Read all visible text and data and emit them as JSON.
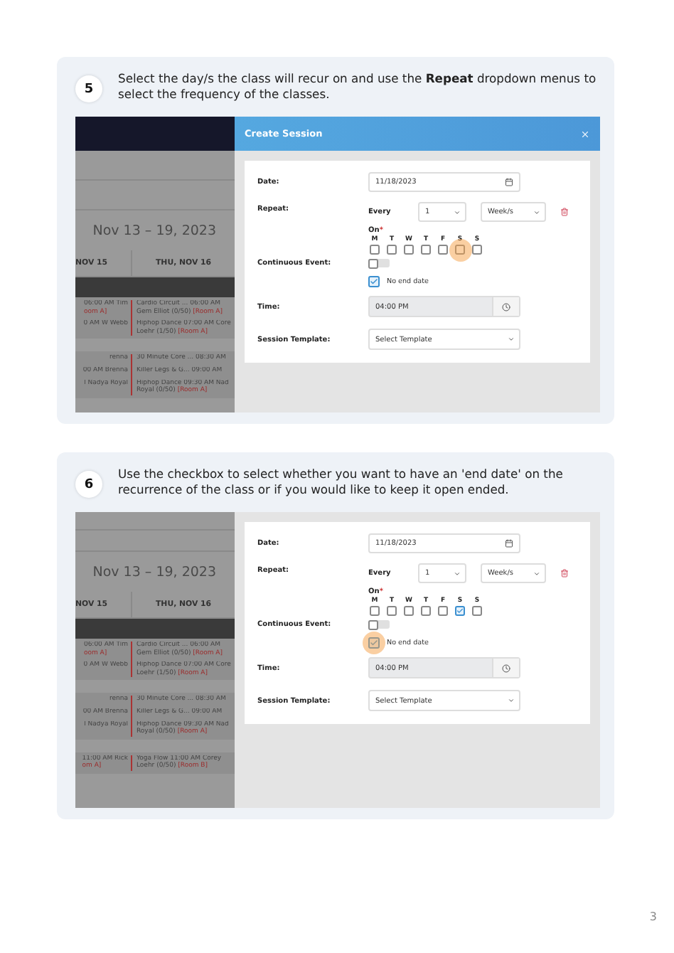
{
  "steps": [
    {
      "number": "5",
      "instruction": "Select the day/s the class will recur on and use the **Repeat** dropdown menus to select the frequency of the classes.",
      "screenshot": {
        "dialog_title": "Create Session",
        "calendar": {
          "top_bar": true,
          "week_title": "Nov 13 – 19, 2023",
          "columns": [
            "NOV 15",
            "THU, NOV 16"
          ],
          "groups": [
            {
              "events": [
                {
                  "left": {
                    "title": "06:00 AM Tim",
                    "room": "oom A]"
                  },
                  "right": {
                    "title": "Cardio Circuit ... 06:00 AM",
                    "detail": "Gem Elliot (0/50)",
                    "room": "[Room A]"
                  }
                },
                {
                  "left": {
                    "title": "0 AM W Webb"
                  },
                  "right": {
                    "title": "Hiphop Dance 07:00 AM Core",
                    "detail": "Loehr (1/50)",
                    "room": "[Room A]"
                  }
                }
              ]
            },
            {
              "events": [
                {
                  "left": {
                    "title": "renna"
                  },
                  "right": {
                    "title": "30 Minute Core ... 08:30 AM"
                  }
                },
                {
                  "left": {
                    "title": "00 AM Brenna"
                  },
                  "right": {
                    "title": "Killer Legs & G... 09:00 AM"
                  }
                },
                {
                  "left": {
                    "title": "l Nadya Royal"
                  },
                  "right": {
                    "title": "Hiphop Dance 09:30 AM Nad",
                    "detail": "Royal (0/50)",
                    "room": "[Room A]"
                  }
                }
              ]
            }
          ]
        },
        "form": {
          "date": {
            "label": "Date:",
            "value": "11/18/2023"
          },
          "repeat": {
            "label": "Repeat:",
            "every": "Every",
            "count": "1",
            "unit": "Week/s"
          },
          "on": {
            "label": "On",
            "required": "*"
          },
          "days": [
            {
              "label": "M",
              "checked": false,
              "highlighted": false
            },
            {
              "label": "T",
              "checked": false,
              "highlighted": false
            },
            {
              "label": "W",
              "checked": false,
              "highlighted": false
            },
            {
              "label": "T",
              "checked": false,
              "highlighted": false
            },
            {
              "label": "F",
              "checked": false,
              "highlighted": false
            },
            {
              "label": "S",
              "checked": false,
              "highlighted": true
            },
            {
              "label": "S",
              "checked": false,
              "highlighted": false
            }
          ],
          "continuous": {
            "label": "Continuous Event:",
            "on": false
          },
          "no_end_date": {
            "label": "No end date",
            "checked": true,
            "highlighted": false
          },
          "time": {
            "label": "Time:",
            "value": "04:00 PM"
          },
          "template": {
            "label": "Session Template:",
            "value": "Select Template"
          }
        }
      }
    },
    {
      "number": "6",
      "instruction": "Use the checkbox to select whether you want to have an 'end date' on the recurrence of the class or if you would like to keep it open ended.",
      "screenshot": {
        "calendar": {
          "top_bar": false,
          "week_title": "Nov 13 – 19, 2023",
          "columns": [
            "NOV 15",
            "THU, NOV 16"
          ],
          "groups": [
            {
              "events": [
                {
                  "left": {
                    "title": "06:00 AM Tim",
                    "room": "oom A]"
                  },
                  "right": {
                    "title": "Cardio Circuit ... 06:00 AM",
                    "detail": "Gem Elliot (0/50)",
                    "room": "[Room A]"
                  }
                },
                {
                  "left": {
                    "title": "0 AM W Webb"
                  },
                  "right": {
                    "title": "Hiphop Dance 07:00 AM Core",
                    "detail": "Loehr (1/50)",
                    "room": "[Room A]"
                  }
                }
              ]
            },
            {
              "events": [
                {
                  "left": {
                    "title": "renna"
                  },
                  "right": {
                    "title": "30 Minute Core ... 08:30 AM"
                  }
                },
                {
                  "left": {
                    "title": "00 AM Brenna"
                  },
                  "right": {
                    "title": "Killer Legs & G... 09:00 AM"
                  }
                },
                {
                  "left": {
                    "title": "l Nadya Royal"
                  },
                  "right": {
                    "title": "Hiphop Dance 09:30 AM Nad",
                    "detail": "Royal (0/50)",
                    "room": "[Room A]"
                  }
                }
              ]
            },
            {
              "events": [
                {
                  "left": {
                    "title": "11:00 AM Rick",
                    "room": "om A]"
                  },
                  "right": {
                    "title": "Yoga Flow 11:00 AM Corey",
                    "detail": "Loehr (0/50)",
                    "room": "[Room B]"
                  }
                }
              ]
            }
          ]
        },
        "form": {
          "date": {
            "label": "Date:",
            "value": "11/18/2023"
          },
          "repeat": {
            "label": "Repeat:",
            "every": "Every",
            "count": "1",
            "unit": "Week/s"
          },
          "on": {
            "label": "On",
            "required": "*"
          },
          "days": [
            {
              "label": "M",
              "checked": false,
              "highlighted": false
            },
            {
              "label": "T",
              "checked": false,
              "highlighted": false
            },
            {
              "label": "W",
              "checked": false,
              "highlighted": false
            },
            {
              "label": "T",
              "checked": false,
              "highlighted": false
            },
            {
              "label": "F",
              "checked": false,
              "highlighted": false
            },
            {
              "label": "S",
              "checked": true,
              "highlighted": false
            },
            {
              "label": "S",
              "checked": false,
              "highlighted": false
            }
          ],
          "continuous": {
            "label": "Continuous Event:",
            "on": false
          },
          "no_end_date": {
            "label": "No end date",
            "checked": true,
            "highlighted": true
          },
          "time": {
            "label": "Time:",
            "value": "04:00 PM"
          },
          "template": {
            "label": "Session Template:",
            "value": "Select Template"
          }
        }
      }
    }
  ],
  "page_number": "3"
}
